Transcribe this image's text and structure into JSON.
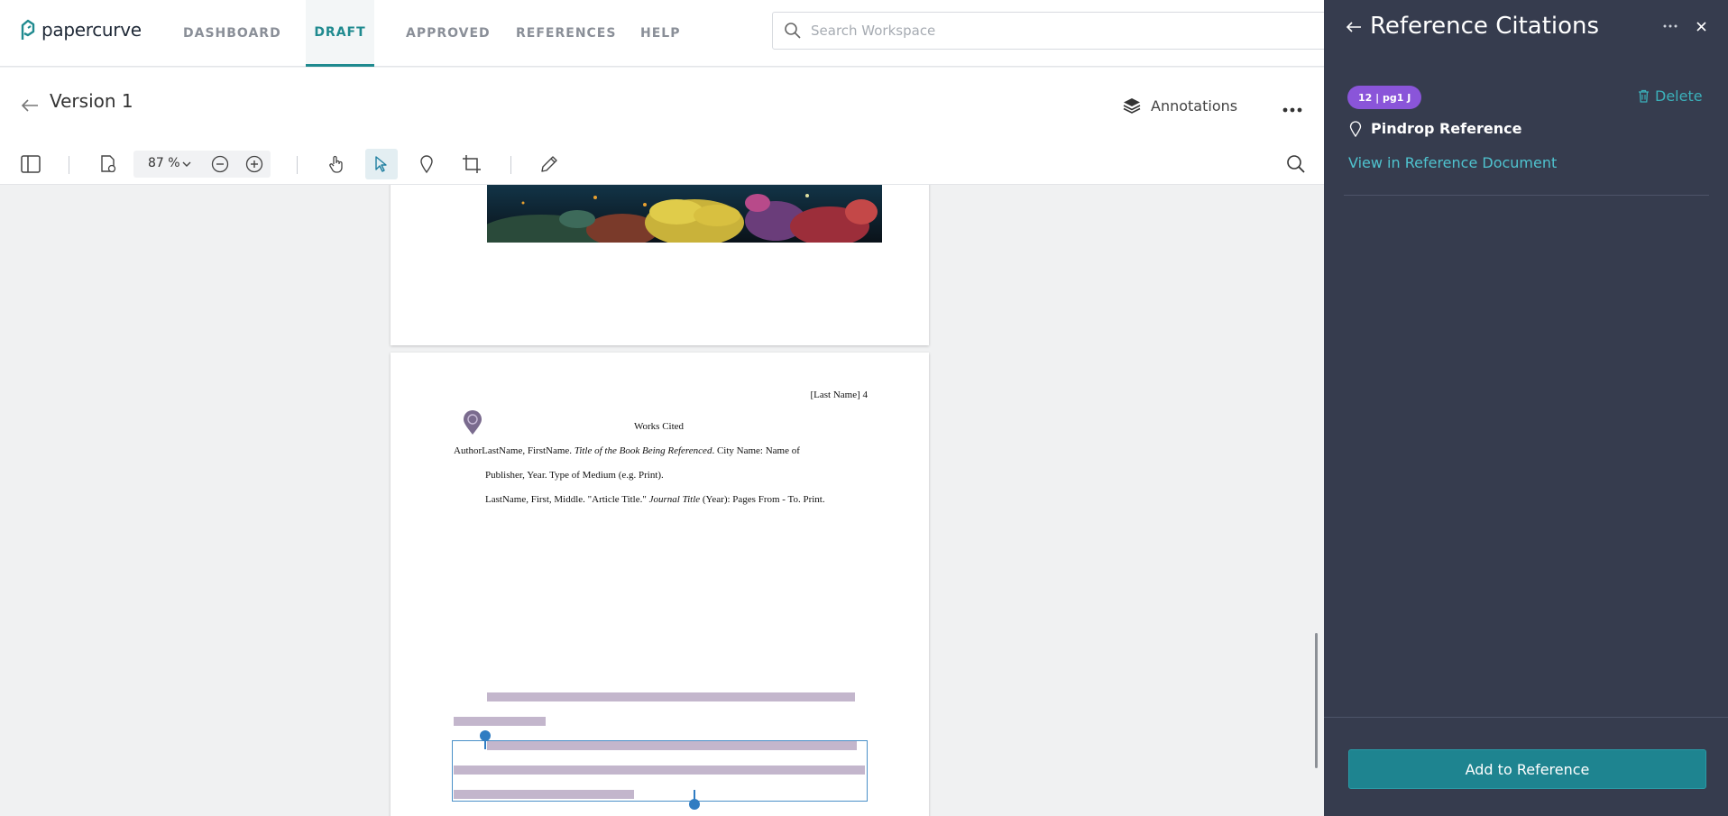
{
  "app": {
    "logo_text": "papercurve"
  },
  "nav": {
    "items": [
      "DASHBOARD",
      "DRAFT",
      "APPROVED",
      "REFERENCES",
      "HELP"
    ],
    "active": "DRAFT"
  },
  "search": {
    "placeholder": "Search Workspace"
  },
  "header": {
    "version_title": "Version 1",
    "annotations_label": "Annotations"
  },
  "toolbar": {
    "zoom_value": "87 %"
  },
  "document": {
    "page_header": "[Last Name] 4",
    "works_cited_title": "Works Cited",
    "citation1_part1": "AuthorLastName, FirstName. ",
    "citation1_italic": "Title of the Book Being Referenced",
    "citation1_part2": ". City Name: Name of",
    "citation1_line2": "Publisher, Year. Type of Medium (e.g. Print).",
    "citation2_part1": "LastName, First, Middle. \"Article Title.\" ",
    "citation2_italic": "Journal Title",
    "citation2_part2": " (Year): Pages From - To. Print."
  },
  "panel": {
    "title": "Reference Citations",
    "badge": "12 | pg1 J",
    "delete_label": "Delete",
    "pin_label": "Pindrop Reference",
    "view_link": "View in Reference Document",
    "add_button": "Add to Reference"
  },
  "colors": {
    "accent": "#1f8a8f",
    "panel_bg": "#363c4e",
    "badge": "#8a55d9",
    "link": "#4fc3cf",
    "highlight": "#c3b6cc"
  }
}
